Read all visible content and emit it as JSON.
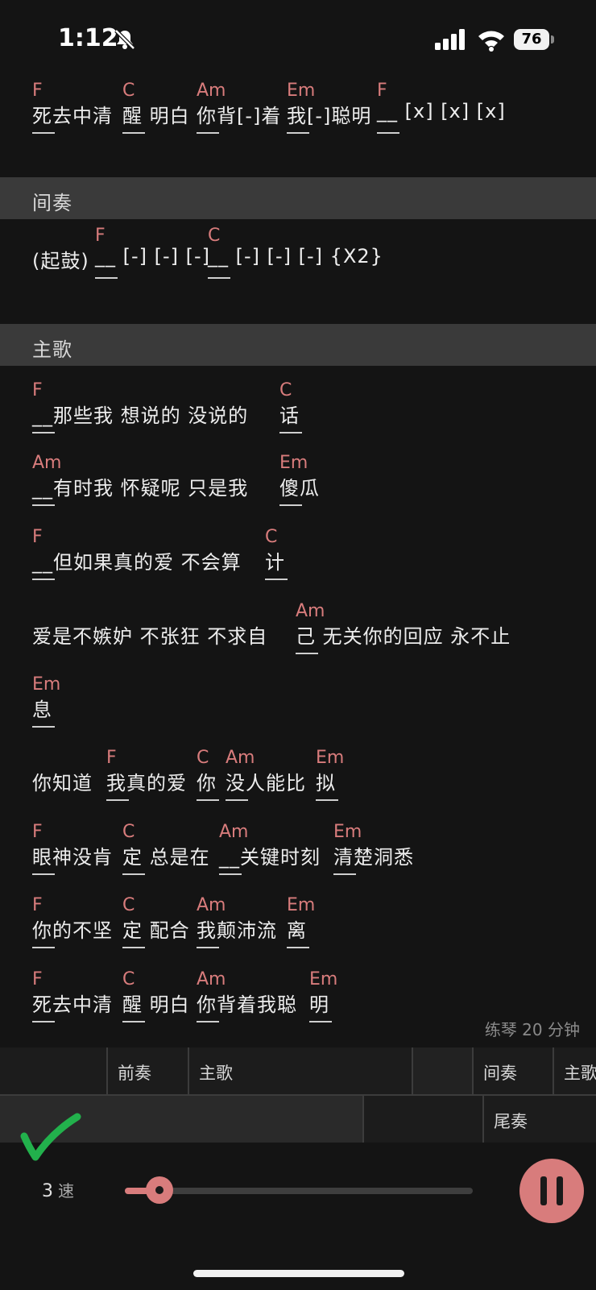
{
  "status_bar": {
    "time": "1:12",
    "battery": "76"
  },
  "sections": [
    {
      "type": "line",
      "segments": [
        {
          "chord": "F",
          "text": "死去中清"
        },
        {
          "chord": "C",
          "text": "醒 明白"
        },
        {
          "chord": "Am",
          "text": "你背[-]着"
        },
        {
          "chord": "Em",
          "text": "我[-]聪明"
        },
        {
          "chord": "F",
          "text": "__ [x] [x] [x]"
        }
      ]
    },
    {
      "type": "header",
      "label": "间奏"
    },
    {
      "type": "line",
      "segments": [
        {
          "chord": "",
          "text": "(起鼓)"
        },
        {
          "chord": "F",
          "text": "__ [-] [-] [-]"
        },
        {
          "chord": "C",
          "text": "__ [-] [-] [-] {X2}"
        }
      ]
    },
    {
      "type": "header",
      "label": "主歌"
    },
    {
      "type": "line",
      "segments": [
        {
          "chord": "F",
          "text": "__那些我 想说的 没说的 "
        },
        {
          "chord": "C",
          "text": "话"
        }
      ]
    },
    {
      "type": "line",
      "segments": [
        {
          "chord": "Am",
          "text": "__有时我 怀疑呢 只是我 "
        },
        {
          "chord": "Em",
          "text": "傻瓜"
        }
      ]
    },
    {
      "type": "line",
      "segments": [
        {
          "chord": "F",
          "text": "__但如果真的爱 不会算"
        },
        {
          "chord": "C",
          "text": "计"
        }
      ]
    },
    {
      "type": "line",
      "segments": [
        {
          "chord": "",
          "text": "爱是不嫉妒 不张狂 不求自"
        },
        {
          "chord": "Am",
          "text": "己 无关你的回应 永不止"
        }
      ]
    },
    {
      "type": "line",
      "segments": [
        {
          "chord": "Em",
          "text": "息"
        }
      ]
    },
    {
      "type": "line",
      "segments": [
        {
          "chord": "",
          "text": "你知道 "
        },
        {
          "chord": "F",
          "text": "我真的爱"
        },
        {
          "chord": "C",
          "text": "你 "
        },
        {
          "chord": "Am",
          "text": "没人能比"
        },
        {
          "chord": "Em",
          "text": "拟"
        }
      ]
    },
    {
      "type": "line",
      "segments": [
        {
          "chord": "F",
          "text": "眼神没肯"
        },
        {
          "chord": "C",
          "text": "定 总是在"
        },
        {
          "chord": "Am",
          "text": "__关键时刻"
        },
        {
          "chord": "Em",
          "text": "清楚洞悉"
        }
      ]
    },
    {
      "type": "line",
      "segments": [
        {
          "chord": "F",
          "text": "你的不坚"
        },
        {
          "chord": "C",
          "text": "定 配合"
        },
        {
          "chord": "Am",
          "text": "我颠沛流"
        },
        {
          "chord": "Em",
          "text": "离"
        }
      ]
    },
    {
      "type": "line",
      "segments": [
        {
          "chord": "F",
          "text": "死去中清"
        },
        {
          "chord": "C",
          "text": "醒 明白"
        },
        {
          "chord": "Am",
          "text": "你背着我聪"
        },
        {
          "chord": "Em",
          "text": "明"
        }
      ]
    }
  ],
  "practice_label": "练琴 20 分钟",
  "timeline": {
    "row1": [
      "",
      "前奏",
      "主歌",
      "",
      "间奏",
      "主歌"
    ],
    "row2": [
      "",
      "",
      "尾奏"
    ]
  },
  "speed": {
    "value": "3",
    "unit": "速",
    "level": 0.1
  },
  "colors": {
    "accent": "#d87c7c",
    "background": "#141414",
    "section_bar": "#3a3a3a",
    "check": "#22b14c"
  }
}
